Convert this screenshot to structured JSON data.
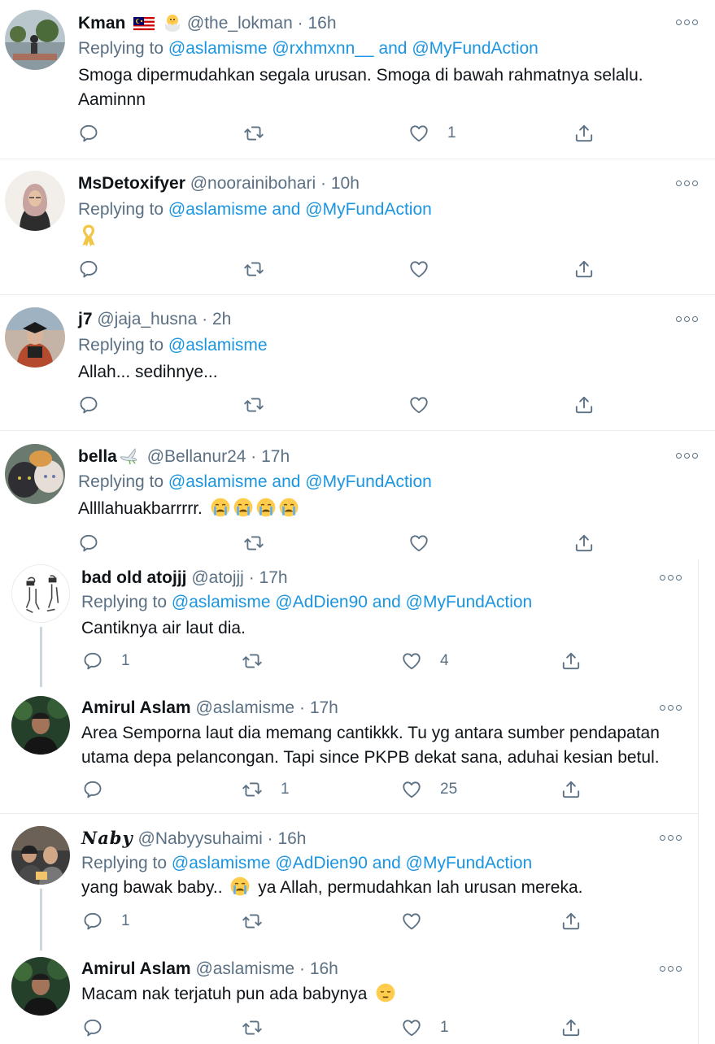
{
  "tweets": [
    {
      "name": "Kman",
      "handle": "@the_lokman",
      "time": "16h",
      "reply_prefix": "Replying to",
      "reply_to": "@aslamisme @rxhmxnn__ and @MyFundAction",
      "text": "Smoga dipermudahkan segala urusan. Smoga di bawah rahmatnya selalu. Aaminnn",
      "replies": "",
      "retweets": "",
      "likes": "1",
      "name_emoji": [
        "malaysia-flag",
        "hatching-chick"
      ]
    },
    {
      "name": "MsDetoxifyer",
      "handle": "@noorainibohari",
      "time": "10h",
      "reply_prefix": "Replying to",
      "reply_to": "@aslamisme and @MyFundAction",
      "text_emoji": "yellow-ribbon",
      "replies": "",
      "retweets": "",
      "likes": ""
    },
    {
      "name": "j7",
      "handle": "@jaja_husna",
      "time": "2h",
      "reply_prefix": "Replying to",
      "reply_to": "@aslamisme",
      "text": "Allah... sedihnye...",
      "replies": "",
      "retweets": "",
      "likes": ""
    },
    {
      "name": "bella",
      "handle": "@Bellanur24",
      "time": "17h",
      "reply_prefix": "Replying to",
      "reply_to": "@aslamisme and @MyFundAction",
      "text": "Allllahuakbarrrrr.",
      "text_emoji": "crying-face x4",
      "name_emoji": [
        "dove"
      ],
      "replies": "",
      "retweets": "",
      "likes": ""
    },
    {
      "name": "bad old atojjj",
      "handle": "@atojjj",
      "time": "17h",
      "reply_prefix": "Replying to",
      "reply_to": "@aslamisme @AdDien90 and @MyFundAction",
      "text": "Cantiknya air laut dia.",
      "replies": "1",
      "retweets": "",
      "likes": "4"
    },
    {
      "name": "Amirul Aslam",
      "handle": "@aslamisme",
      "time": "17h",
      "text": "Area Semporna laut dia memang cantikkk. Tu yg antara sumber pendapatan utama depa pelancongan. Tapi since PKPB dekat sana, aduhai kesian betul.",
      "replies": "",
      "retweets": "1",
      "likes": "25"
    },
    {
      "name": "𝑵𝒂𝒃𝒚",
      "handle": "@Nabyysuhaimi",
      "time": "16h",
      "reply_prefix": "Replying to",
      "reply_to": "@aslamisme @AdDien90 and @MyFundAction",
      "text_before": "yang bawak baby..",
      "text_after": "ya Allah, permudahkan lah urusan mereka.",
      "replies": "1",
      "retweets": "",
      "likes": ""
    },
    {
      "name": "Amirul Aslam",
      "handle": "@aslamisme",
      "time": "16h",
      "text": "Macam nak terjatuh pun ada babynya",
      "text_emoji": "pensive-face",
      "replies": "",
      "retweets": "",
      "likes": "1"
    }
  ],
  "ui": {
    "dot": "·",
    "accent": "#1b95e0",
    "muted": "#5b7083",
    "icons": [
      "reply-icon",
      "retweet-icon",
      "like-icon",
      "share-icon",
      "more-icon"
    ]
  }
}
